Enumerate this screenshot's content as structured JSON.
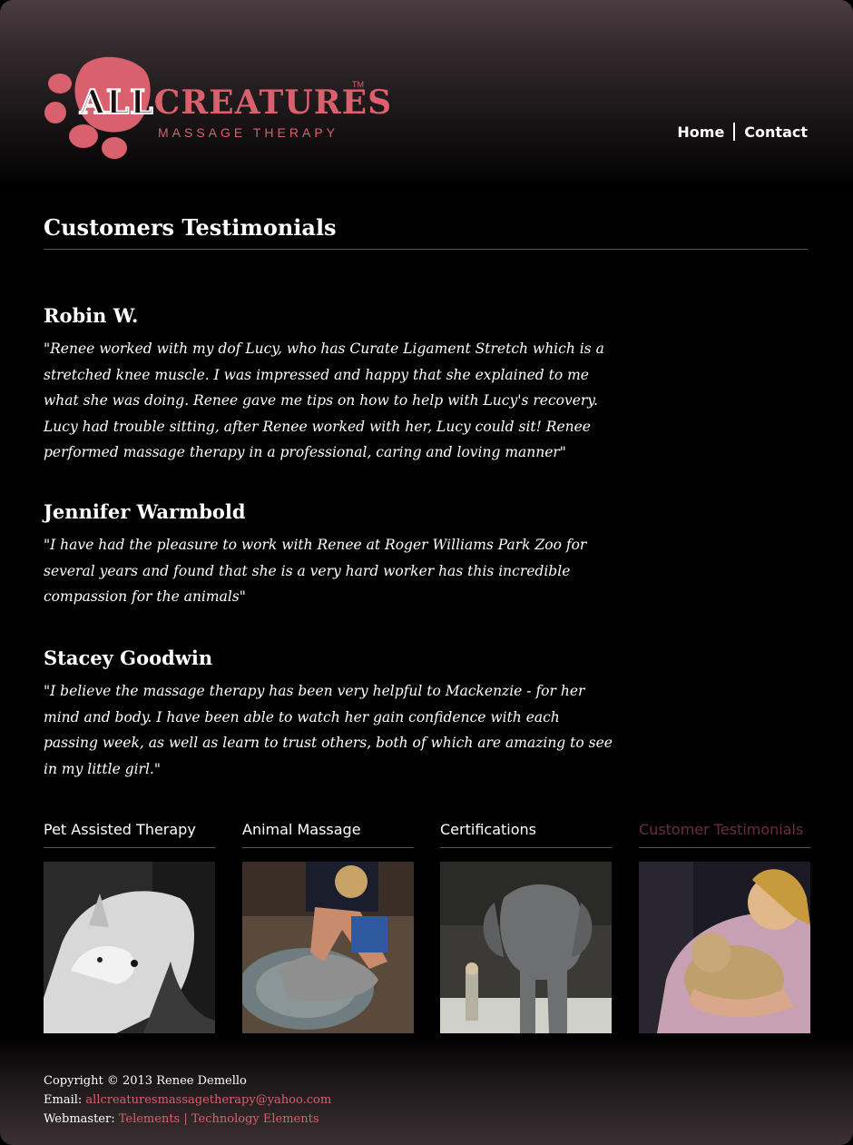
{
  "brand": {
    "word_all": "ALL",
    "word_rest": "CREATURES",
    "tagline": "MASSAGE THERAPY",
    "tm": "TM",
    "color": "#d9606d"
  },
  "nav": {
    "home": "Home",
    "contact": "Contact"
  },
  "main": {
    "title": "Customers Testimonials",
    "testimonials": [
      {
        "name": "Robin W.",
        "quote": "\"Renee worked with my dof Lucy, who has Curate Ligament Stretch which is a stretched knee muscle. I was impressed and happy that she explained to me what she was doing. Renee gave me tips on how to help with Lucy's recovery. Lucy had trouble sitting, after Renee worked with her, Lucy could sit! Renee performed massage therapy in a professional, caring and loving manner\""
      },
      {
        "name": "Jennifer Warmbold",
        "quote": "\"I have had the pleasure to work with Renee at Roger Williams Park Zoo for several years and found that she is a very hard worker has this incredible compassion for the animals\""
      },
      {
        "name": "Stacey Goodwin",
        "quote": "\"I believe the massage therapy has been very helpful to Mackenzie - for her mind and body. I have been able to watch her gain confidence with each passing week, as well as learn to trust others, both of which are amazing to see in my little girl.\""
      }
    ]
  },
  "gallery": [
    {
      "title": "Pet Assisted Therapy",
      "icon": "wolf-photo"
    },
    {
      "title": "Animal Massage",
      "icon": "dog-massage-photo"
    },
    {
      "title": "Certifications",
      "icon": "elephant-photo"
    },
    {
      "title": "Customer Testimonials",
      "icon": "lion-cub-photo",
      "active": true
    }
  ],
  "footer": {
    "copyright": "Copyright © 2013 Renee Demello",
    "email_label": "Email:",
    "email": "allcreaturesmassagetherapy@yahoo.com",
    "webmaster_label": "Webmaster:",
    "webmaster_link1": "Telements",
    "divider": "|",
    "webmaster_link2": "Technology Elements"
  }
}
